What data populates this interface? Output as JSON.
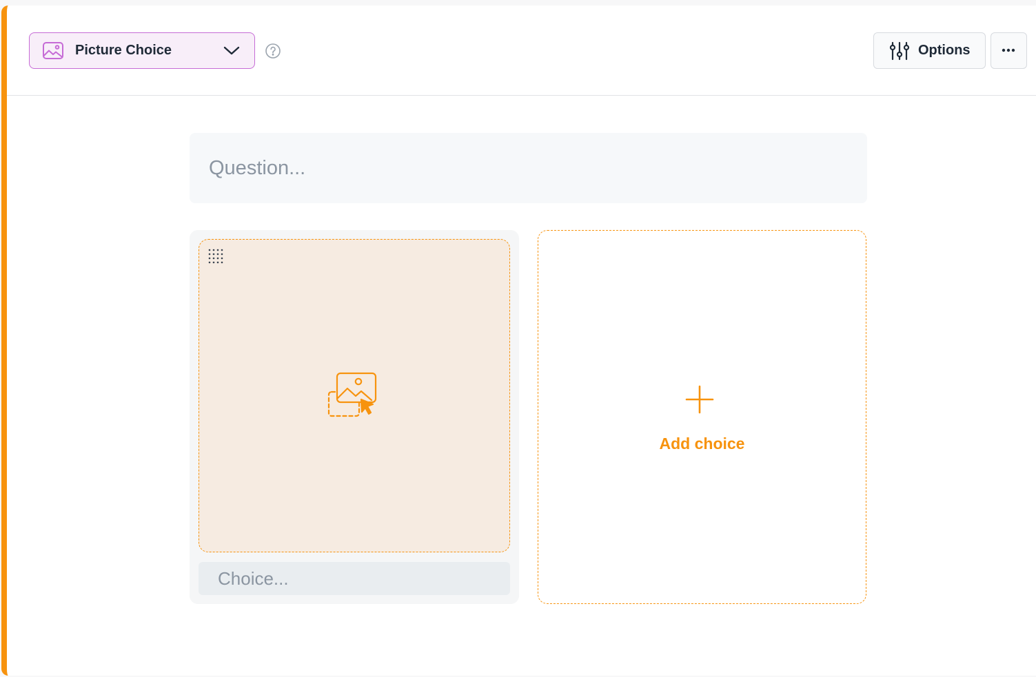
{
  "question_type": {
    "label": "Picture Choice",
    "icon": "image-icon",
    "dropdown_icon": "chevron-down-icon",
    "help_icon": "help-circle-icon"
  },
  "toolbar": {
    "options_label": "Options",
    "options_icon": "sliders-icon",
    "more_icon": "more-horizontal-icon"
  },
  "question": {
    "placeholder": "Question...",
    "value": ""
  },
  "choices": [
    {
      "placeholder": "Choice...",
      "value": "",
      "upload_icon": "image-upload-icon",
      "drag_icon": "drag-handle-icon"
    }
  ],
  "add_choice": {
    "label": "Add choice",
    "icon": "plus-icon"
  },
  "colors": {
    "accent": "#f7930e",
    "type_accent": "#c66bd6",
    "type_background": "#f8eef9",
    "dropzone_background": "#f6ebe1",
    "text_primary": "#1f2a37",
    "placeholder": "#8b95a1"
  }
}
